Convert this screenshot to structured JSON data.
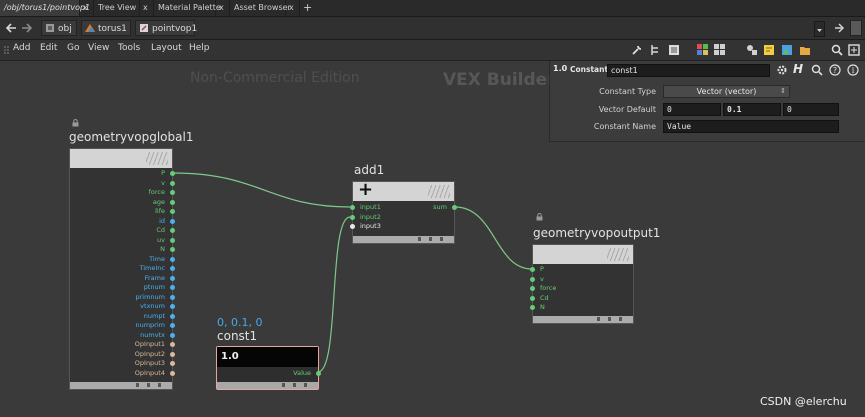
{
  "tabs": [
    {
      "label": "/obj/torus1/pointvop1",
      "active": true
    },
    {
      "label": "Tree View",
      "active": false
    },
    {
      "label": "Material Palette",
      "active": false
    },
    {
      "label": "Asset Browser",
      "active": false
    }
  ],
  "tab_close": "x",
  "tab_add": "+",
  "path": {
    "crumbs": [
      "obj",
      "torus1",
      "pointvop1"
    ]
  },
  "menu": {
    "items": [
      "Add",
      "Edit",
      "Go",
      "View",
      "Tools",
      "Layout",
      "Help"
    ]
  },
  "network": {
    "watermark_edition": "Non-Commercial Edition",
    "watermark_context": "VEX Builder",
    "nodes": {
      "global": {
        "name": "geometryvopglobal1",
        "outputs": [
          "P",
          "v",
          "force",
          "age",
          "life",
          "id",
          "Cd",
          "uv",
          "N",
          "Time",
          "TimeInc",
          "Frame",
          "ptnum",
          "primnum",
          "vtxnum",
          "numpt",
          "numprim",
          "numvtx",
          "OpInput1",
          "OpInput2",
          "OpInput3",
          "OpInput4"
        ]
      },
      "add": {
        "name": "add1",
        "inputs": [
          "input1",
          "input2",
          "input3"
        ],
        "outputs": [
          "sum"
        ],
        "icon_glyph": "+"
      },
      "output": {
        "name": "geometryvopoutput1",
        "inputs": [
          "P",
          "v",
          "force",
          "Cd",
          "N"
        ]
      },
      "const": {
        "name": "const1",
        "badge": "0, 0.1, 0",
        "icon_text": "1.0",
        "outputs": [
          "Value"
        ]
      }
    }
  },
  "parameters": {
    "node_type_icon": "1.0",
    "node_type": "Constant",
    "node_name": "const1",
    "rows": [
      {
        "label": "Constant Type",
        "menu_value": "Vector (vector)"
      },
      {
        "label": "Vector Default",
        "values": [
          "0",
          "0.1",
          "0"
        ]
      },
      {
        "label": "Constant Name",
        "value": "Value"
      }
    ]
  },
  "footer_credit": "CSDN @elerchu",
  "colors": {
    "port_green": "#66cc77",
    "port_cyan": "#4ab0f0",
    "port_tan": "#d9b99a",
    "port_white": "#e8e8e8",
    "wire": "#7fc88a",
    "const_border": "#e8a3a3"
  }
}
